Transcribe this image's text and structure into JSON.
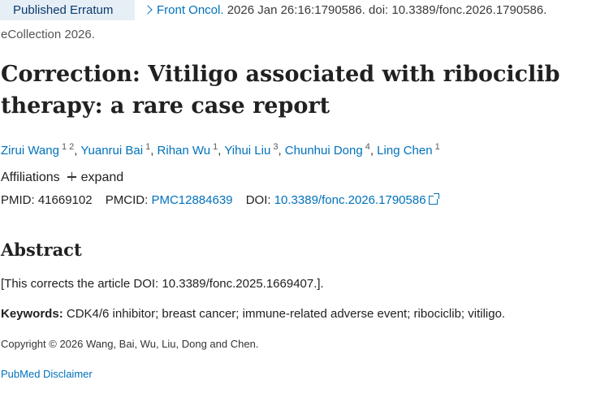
{
  "header": {
    "badge": "Published Erratum",
    "journal_link": "Front Oncol.",
    "citation": " 2026 Jan 26:16:1790586. doi: 10.3389/fonc.2026.1790586.",
    "ecollection": "eCollection 2026."
  },
  "article": {
    "title": "Correction: Vitiligo associated with ribociclib therapy: a rare case report"
  },
  "authors": [
    {
      "name": "Zirui Wang",
      "sup": "1 2"
    },
    {
      "name": "Yuanrui Bai",
      "sup": "1"
    },
    {
      "name": "Rihan Wu",
      "sup": "1"
    },
    {
      "name": "Yihui Liu",
      "sup": "3"
    },
    {
      "name": "Chunhui Dong",
      "sup": "4"
    },
    {
      "name": "Ling Chen",
      "sup": "1"
    }
  ],
  "affiliations": {
    "label": "Affiliations",
    "expand_label": "expand"
  },
  "identifiers": {
    "pmid_label": "PMID:",
    "pmid": "41669102",
    "pmcid_label": "PMCID:",
    "pmcid": "PMC12884639",
    "doi_label": "DOI:",
    "doi": "10.3389/fonc.2026.1790586"
  },
  "abstract": {
    "heading": "Abstract",
    "text": "[This corrects the article DOI: 10.3389/fonc.2025.1669407.].",
    "keywords_label": "Keywords:",
    "keywords": " CDK4/6 inhibitor; breast cancer; immune-related adverse event; ribociclib; vitiligo."
  },
  "copyright": "Copyright © 2026 Wang, Bai, Wu, Liu, Dong and Chen.",
  "disclaimer_link": "PubMed Disclaimer",
  "colors": {
    "link": "#0071bc",
    "badge_bg": "#e6eef6",
    "badge_text": "#0b3a6b"
  }
}
